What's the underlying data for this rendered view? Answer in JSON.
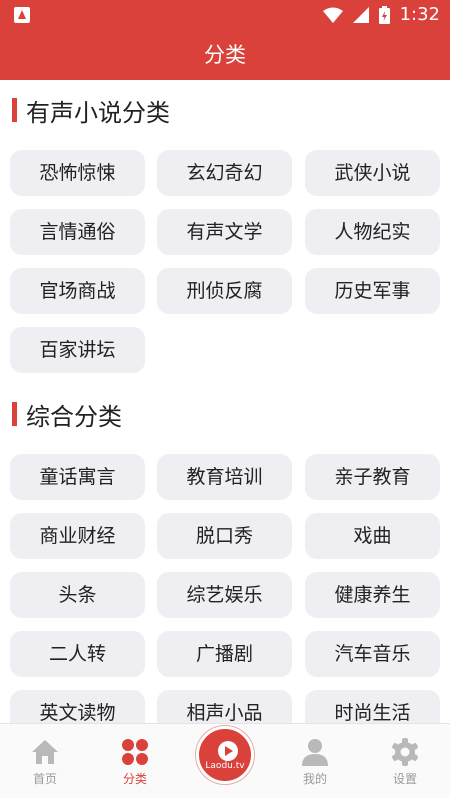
{
  "status_bar": {
    "time": "1:32"
  },
  "header": {
    "title": "分类"
  },
  "sections": [
    {
      "title": "有声小说分类",
      "items": [
        "恐怖惊悚",
        "玄幻奇幻",
        "武侠小说",
        "言情通俗",
        "有声文学",
        "人物纪实",
        "官场商战",
        "刑侦反腐",
        "历史军事",
        "百家讲坛"
      ]
    },
    {
      "title": "综合分类",
      "items": [
        "童话寓言",
        "教育培训",
        "亲子教育",
        "商业财经",
        "脱口秀",
        "戏曲",
        "头条",
        "综艺娱乐",
        "健康养生",
        "二人转",
        "广播剧",
        "汽车音乐",
        "英文读物",
        "相声小品",
        "时尚生活"
      ]
    }
  ],
  "nav": {
    "home": "首页",
    "category": "分类",
    "center_brand": "Laodu.tv",
    "mine": "我的",
    "settings": "设置"
  },
  "colors": {
    "accent": "#d9413a",
    "chip_bg": "#eeeef3",
    "nav_inactive": "#9a9a9a"
  },
  "icons": {
    "app": "app-logo-icon",
    "wifi": "wifi-icon",
    "signal": "cell-signal-icon",
    "battery": "battery-charging-icon",
    "home": "home-icon",
    "category": "grid-dots-icon",
    "center": "play-logo-icon",
    "mine": "user-icon",
    "settings": "gear-icon"
  }
}
